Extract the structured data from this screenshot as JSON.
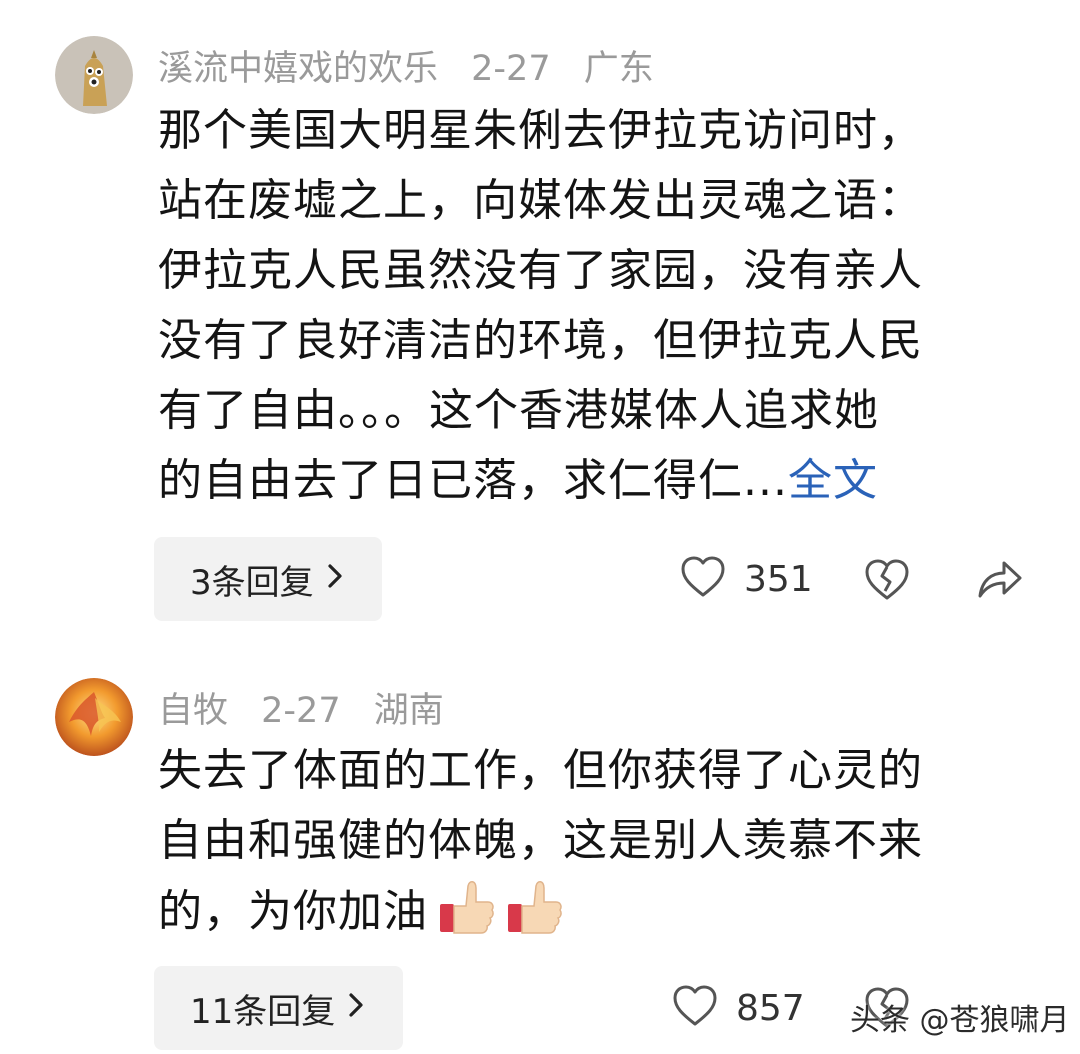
{
  "comments": [
    {
      "username": "溪流中嬉戏的欢乐",
      "date": "2-27",
      "location": "广东",
      "lines": [
        "那个美国大明星朱俐去伊拉克访问时，",
        "站在废墟之上，向媒体发出灵魂之语：",
        "伊拉克人民虽然没有了家园，没有亲人",
        "没有了良好清洁的环境，但伊拉克人民",
        "有了自由。。。这个香港媒体人追求她",
        "的自由去了日已落，求仁得仁..."
      ],
      "more_label": "全文",
      "replies_label": "3条回复",
      "likes": "351",
      "avatar_icon": "cartoon-character-avatar",
      "actions": [
        "heart-icon",
        "broken-heart-icon",
        "share-icon"
      ]
    },
    {
      "username": "自牧",
      "date": "2-27",
      "location": "湖南",
      "lines": [
        "失去了体面的工作，但你获得了心灵的",
        "自由和强健的体魄，这是别人羡慕不来",
        "的，为你加油"
      ],
      "emoji": [
        "thumbs-up-icon",
        "thumbs-up-icon"
      ],
      "replies_label": "11条回复",
      "likes": "857",
      "avatar_icon": "phoenix-avatar",
      "actions": [
        "heart-icon",
        "broken-heart-icon"
      ]
    }
  ],
  "watermark": "头条 @苍狼啸月",
  "colors": {
    "link": "#2a62b8",
    "meta": "#9a9a9a",
    "text": "#141414",
    "pill": "#f2f2f2"
  }
}
